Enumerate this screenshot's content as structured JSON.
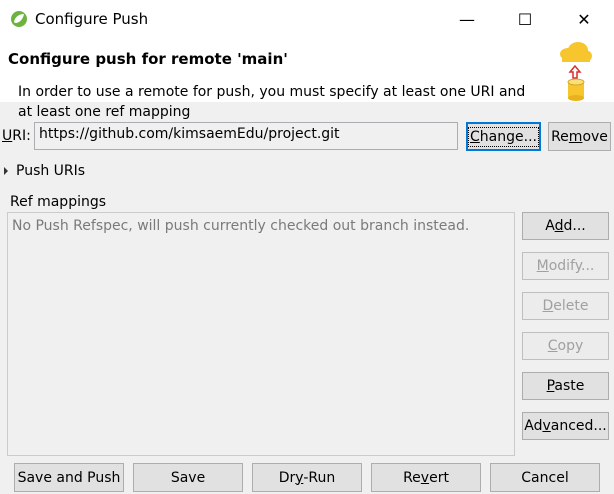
{
  "window": {
    "title": "Configure Push",
    "minimize_glyph": "—",
    "maximize_glyph": "☐",
    "close_glyph": "✕"
  },
  "header": {
    "title": "Configure push for remote 'main'",
    "message": "In order to use a remote for push, you must specify at least one URI and at least one ref mapping",
    "image_icon": "cloud-database-push-icon"
  },
  "uri": {
    "label": "URI:",
    "value": "https://github.com/kimsaemEdu/project.git",
    "change_button": "Change...",
    "remove_button": "Remove"
  },
  "push_uris": {
    "label": "Push URIs"
  },
  "ref_mappings": {
    "label": "Ref mappings",
    "placeholder": "No Push Refspec, will push currently checked out branch instead.",
    "buttons": {
      "add": "Add...",
      "modify": "Modify...",
      "delete": "Delete",
      "copy": "Copy",
      "paste": "Paste",
      "advanced": "Advanced..."
    }
  },
  "footer": {
    "save_and_push": "Save and Push",
    "save": "Save",
    "dry_run": "Dry-Run",
    "revert": "Revert",
    "cancel": "Cancel"
  },
  "colors": {
    "focus_border": "#0078d7",
    "spring_green": "#6db33f",
    "cloud_yellow": "#f7c62f",
    "arrow_red": "#d9302c"
  }
}
